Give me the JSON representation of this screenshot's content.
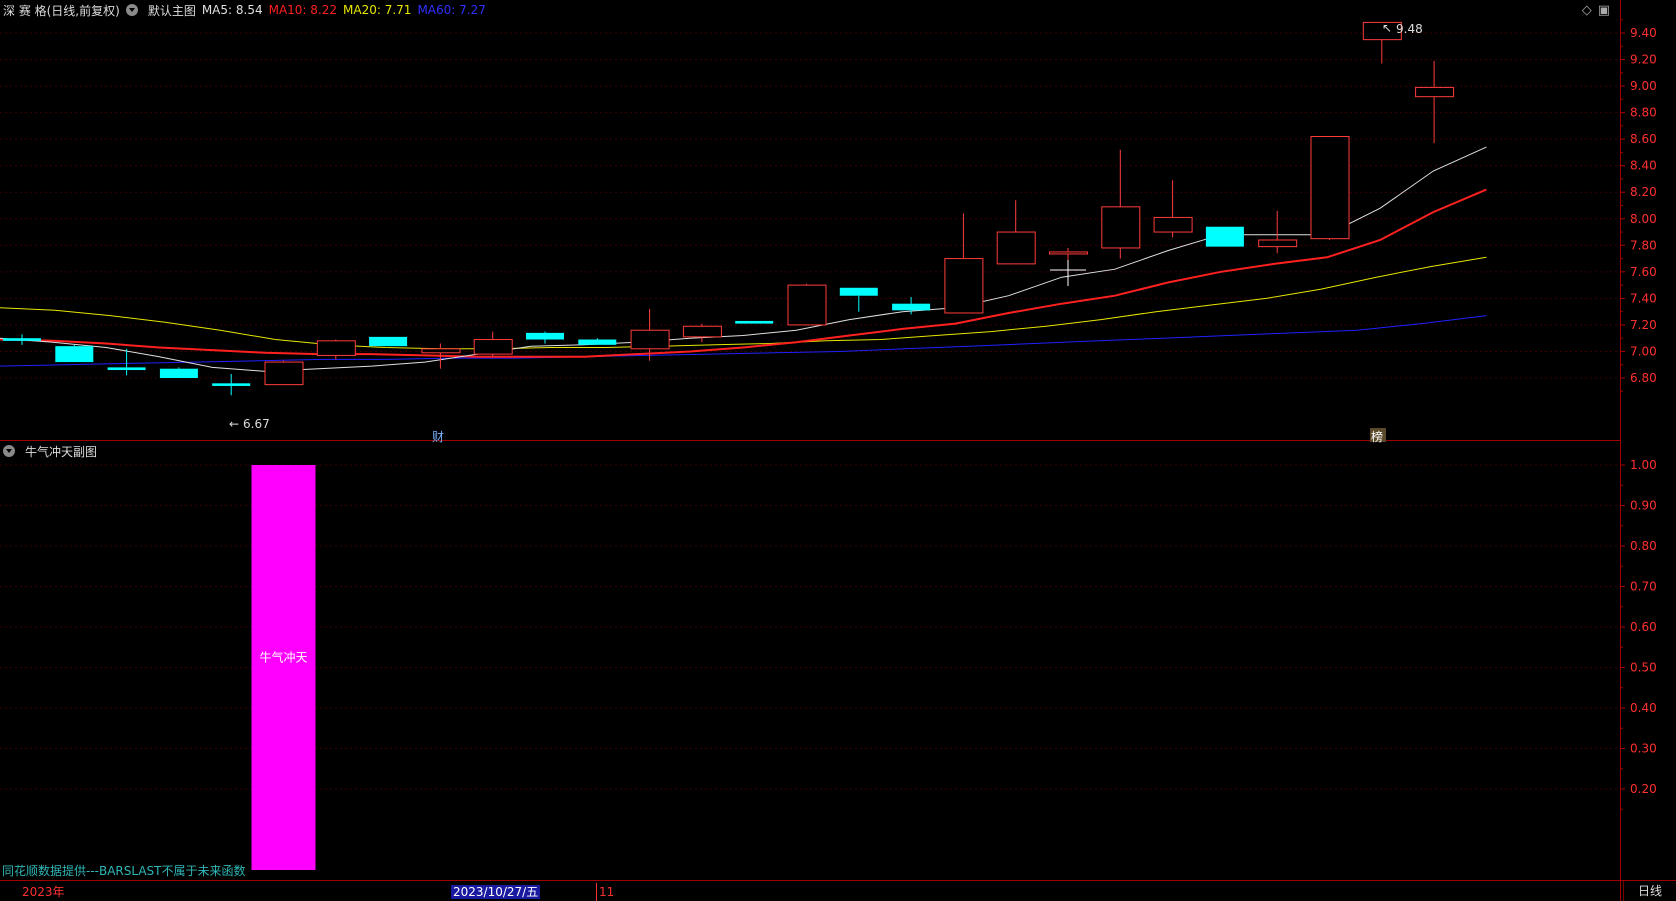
{
  "main_header": {
    "stock": "深 赛 格(日线,前复权)",
    "chart_name": "默认主图",
    "ma5": "MA5: 8.54",
    "ma10": "MA10: 8.22",
    "ma20": "MA20: 7.71",
    "ma60": "MA60: 7.27"
  },
  "top_icons": [
    "diamond-icon",
    "window-icon"
  ],
  "sub_header": {
    "title": "牛气冲天副图"
  },
  "annotations": {
    "high": "9.48",
    "low": "6.67",
    "marker_cai": "财",
    "marker_bang": "榜",
    "bar_label": "牛气冲天"
  },
  "footer": {
    "note": "同花顺数据提供---BARSLAST不属于未来函数",
    "year": "2023年",
    "date": "2023/10/27/五",
    "month": "11",
    "period_button": "日线"
  },
  "colors": {
    "up": "#ff3c3c",
    "down": "#00ffff",
    "ma5": "#e0e0e0",
    "ma10": "#ff2020",
    "ma20": "#e6e600",
    "ma60": "#2020ff",
    "bar": "#ff00ff",
    "axis": "#a00000"
  },
  "chart_data": [
    {
      "type": "candlestick",
      "title": "深 赛 格(日线,前复权)",
      "y_ticks": [
        6.8,
        7.0,
        7.2,
        7.4,
        7.6,
        7.8,
        8.0,
        8.2,
        8.4,
        8.6,
        8.8,
        9.0,
        9.2,
        9.4
      ],
      "ylim": [
        6.57,
        9.5
      ],
      "candles": [
        {
          "o": 7.1,
          "h": 7.13,
          "l": 7.05,
          "c": 7.08
        },
        {
          "o": 7.04,
          "h": 7.05,
          "l": 6.92,
          "c": 6.92
        },
        {
          "o": 6.88,
          "h": 7.02,
          "l": 6.82,
          "c": 6.86
        },
        {
          "o": 6.87,
          "h": 6.88,
          "l": 6.8,
          "c": 6.8
        },
        {
          "o": 6.76,
          "h": 6.83,
          "l": 6.67,
          "c": 6.74
        },
        {
          "o": 6.75,
          "h": 6.93,
          "l": 6.75,
          "c": 6.92
        },
        {
          "o": 6.97,
          "h": 7.09,
          "l": 6.94,
          "c": 7.08
        },
        {
          "o": 7.11,
          "h": 7.11,
          "l": 7.04,
          "c": 7.04
        },
        {
          "o": 6.99,
          "h": 7.06,
          "l": 6.87,
          "c": 7.02
        },
        {
          "o": 6.98,
          "h": 7.15,
          "l": 6.96,
          "c": 7.09
        },
        {
          "o": 7.14,
          "h": 7.15,
          "l": 7.06,
          "c": 7.09
        },
        {
          "o": 7.09,
          "h": 7.1,
          "l": 7.05,
          "c": 7.05
        },
        {
          "o": 7.02,
          "h": 7.32,
          "l": 6.93,
          "c": 7.16
        },
        {
          "o": 7.11,
          "h": 7.21,
          "l": 7.07,
          "c": 7.19
        },
        {
          "o": 7.23,
          "h": 7.23,
          "l": 7.21,
          "c": 7.21
        },
        {
          "o": 7.2,
          "h": 7.51,
          "l": 7.2,
          "c": 7.5
        },
        {
          "o": 7.48,
          "h": 7.48,
          "l": 7.3,
          "c": 7.42
        },
        {
          "o": 7.36,
          "h": 7.41,
          "l": 7.28,
          "c": 7.31
        },
        {
          "o": 7.29,
          "h": 8.04,
          "l": 7.29,
          "c": 7.7
        },
        {
          "o": 7.66,
          "h": 8.14,
          "l": 7.66,
          "c": 7.9
        },
        {
          "o": 7.75,
          "h": 7.78,
          "l": 7.62,
          "c": 7.75
        },
        {
          "o": 7.78,
          "h": 8.52,
          "l": 7.7,
          "c": 8.09
        },
        {
          "o": 7.9,
          "h": 8.29,
          "l": 7.86,
          "c": 8.01
        },
        {
          "o": 7.94,
          "h": 7.94,
          "l": 7.79,
          "c": 7.79
        },
        {
          "o": 7.79,
          "h": 8.06,
          "l": 7.74,
          "c": 7.84
        },
        {
          "o": 7.85,
          "h": 8.62,
          "l": 7.84,
          "c": 8.62
        },
        {
          "o": 9.35,
          "h": 9.48,
          "l": 9.17,
          "c": 9.48
        },
        {
          "o": 8.92,
          "h": 9.19,
          "l": 8.57,
          "c": 8.99
        }
      ],
      "ma5": [
        7.1,
        7.07,
        7.03,
        6.96,
        6.88,
        6.85,
        6.87,
        6.89,
        6.92,
        6.98,
        7.04,
        7.05,
        7.07,
        7.1,
        7.12,
        7.16,
        7.24,
        7.3,
        7.33,
        7.42,
        7.56,
        7.62,
        7.76,
        7.88,
        7.88,
        7.88,
        8.08,
        8.36,
        8.54
      ],
      "ma10": [
        7.09,
        7.08,
        7.06,
        7.03,
        7.01,
        6.99,
        6.98,
        6.98,
        6.97,
        6.96,
        6.96,
        6.96,
        6.98,
        7.0,
        7.03,
        7.07,
        7.12,
        7.17,
        7.21,
        7.29,
        7.36,
        7.42,
        7.52,
        7.6,
        7.66,
        7.71,
        7.84,
        8.05,
        8.22
      ],
      "ma20": [
        7.33,
        7.31,
        7.27,
        7.22,
        7.16,
        7.09,
        7.05,
        7.03,
        7.02,
        7.02,
        7.03,
        7.03,
        7.04,
        7.05,
        7.06,
        7.08,
        7.09,
        7.12,
        7.15,
        7.19,
        7.24,
        7.3,
        7.35,
        7.4,
        7.47,
        7.56,
        7.64,
        7.71
      ],
      "ma60": [
        6.89,
        6.9,
        6.91,
        6.92,
        6.93,
        6.94,
        6.94,
        6.95,
        6.95,
        6.96,
        6.97,
        6.98,
        6.99,
        7.0,
        7.02,
        7.04,
        7.06,
        7.08,
        7.1,
        7.12,
        7.14,
        7.16,
        7.21,
        7.27
      ]
    },
    {
      "type": "bar",
      "title": "牛气冲天副图",
      "y_ticks": [
        0.2,
        0.3,
        0.4,
        0.5,
        0.6,
        0.7,
        0.8,
        0.9,
        1.0
      ],
      "ylim": [
        0,
        1
      ],
      "bars": [
        {
          "index": 5,
          "value": 1.0,
          "label": "牛气冲天"
        }
      ]
    }
  ]
}
